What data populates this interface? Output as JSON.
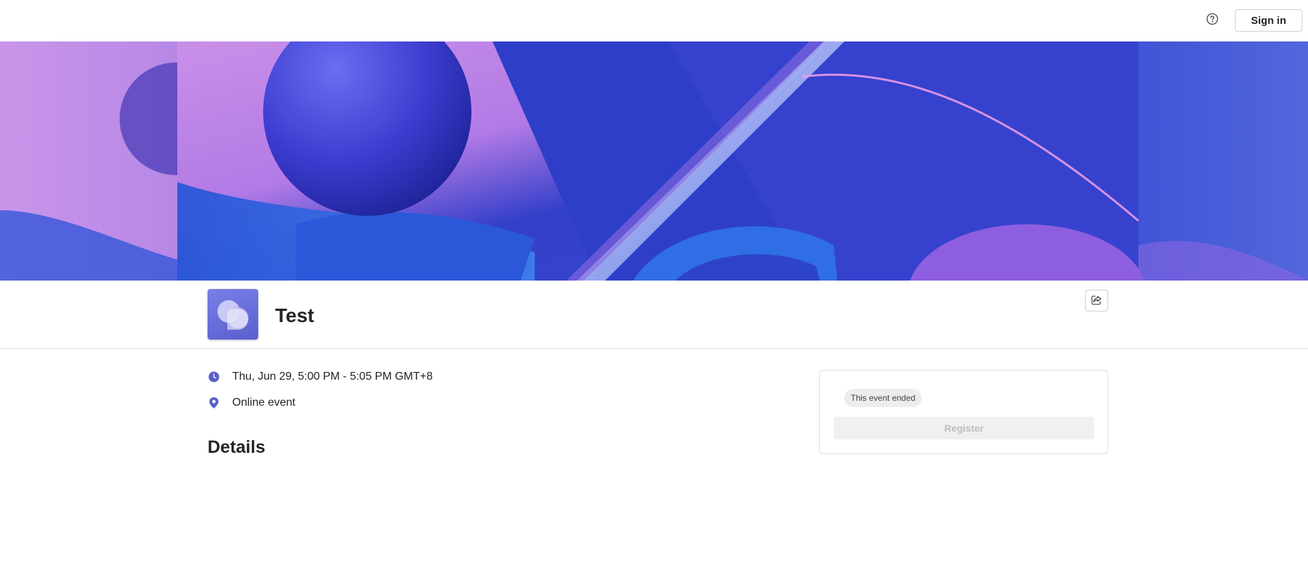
{
  "header": {
    "help_icon": "question-circle-icon",
    "signin_label": "Sign in"
  },
  "banner": {
    "image": "abstract-3d-purple-blue-shapes"
  },
  "event": {
    "title": "Test",
    "logo_icon": "teams-event-chat-bubbles-icon",
    "share_icon": "share-icon",
    "datetime": "Thu, Jun 29, 5:00 PM - 5:05 PM GMT+8",
    "datetime_icon": "clock-icon",
    "location": "Online event",
    "location_icon": "location-pin-icon",
    "details_heading": "Details"
  },
  "registration": {
    "status_badge": "This event ended",
    "register_label": "Register"
  },
  "colors": {
    "accent": "#5b5fc7",
    "banner_purple": "#c58ae4",
    "banner_blue": "#3a48d6"
  }
}
